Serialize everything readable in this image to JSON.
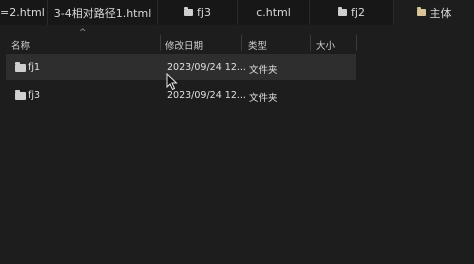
{
  "tabs": [
    {
      "label": "=2.html",
      "icon": "none"
    },
    {
      "label": "3-4相对路径1.html",
      "icon": "none"
    },
    {
      "label": "fj3",
      "icon": "folder-icon"
    },
    {
      "label": "c.html",
      "icon": "none"
    },
    {
      "label": "fj2",
      "icon": "folder-icon"
    },
    {
      "label": "主体",
      "icon": "folder-icon"
    }
  ],
  "columns": {
    "name": "名称",
    "modified": "修改日期",
    "type": "类型",
    "size": "大小"
  },
  "sort_indicator": "^",
  "rows": [
    {
      "name": "fj1",
      "modified": "2023/09/24 12...",
      "type": "文件夹",
      "size": "",
      "selected": true
    },
    {
      "name": "fj3",
      "modified": "2023/09/24 12...",
      "type": "文件夹",
      "size": "",
      "selected": false
    }
  ],
  "colors": {
    "background": "#1d1d1d",
    "tabbar": "#171717",
    "selected_row": "#2e2e2e",
    "active_folder": "#d9c49a"
  }
}
